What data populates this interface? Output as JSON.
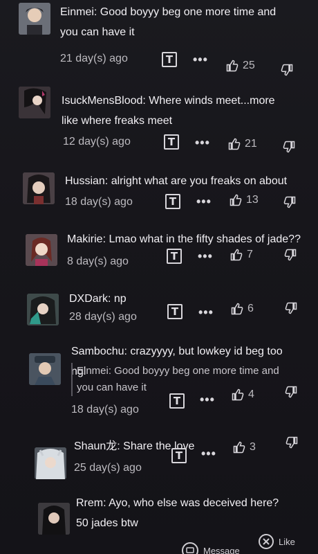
{
  "comments": [
    {
      "user": "Einmei",
      "text": "Einmei: Good boyyy beg one more time and you can have it",
      "time": "21 day(s) ago",
      "likes": "25"
    },
    {
      "user": "IsuckMensBlood",
      "text": "IsuckMensBlood: Where winds meet...more like where freaks meet",
      "time": "12 day(s) ago",
      "likes": "21"
    },
    {
      "user": "Hussian",
      "text": "Hussian: alright what are you freaks on about",
      "time": "18 day(s) ago",
      "likes": "13"
    },
    {
      "user": "Makirie",
      "text": "Makirie: Lmao what in the fifty shades of jade??",
      "time": "8 day(s) ago",
      "likes": "7"
    },
    {
      "user": "DXDark",
      "text": "DXDark: np",
      "time": "28 day(s) ago",
      "likes": "6"
    },
    {
      "user": "Sambochu",
      "text": "Sambochu: crazyyyy, but lowkey id beg too ngl",
      "quote": "Einmei: Good boyyy beg one more time and you can have it",
      "time": "18 day(s) ago",
      "likes": "4"
    },
    {
      "user": "Shaun龙",
      "text": "Shaun龙: Share the love",
      "time": "25 day(s) ago",
      "likes": "3"
    },
    {
      "user": "Rrem",
      "text": "Rrem: Ayo, who else was deceived here? 50 jades btw"
    }
  ],
  "bottom_bar": {
    "message_label": "Message",
    "like_label": "Like"
  },
  "icons": {
    "translate": "translate-icon",
    "more": "more-icon",
    "like": "thumbs-up-icon",
    "dislike": "thumbs-down-icon"
  },
  "colors": {
    "background": "#17161b",
    "text": "#f2f0f4",
    "muted": "#bdbbc0"
  }
}
